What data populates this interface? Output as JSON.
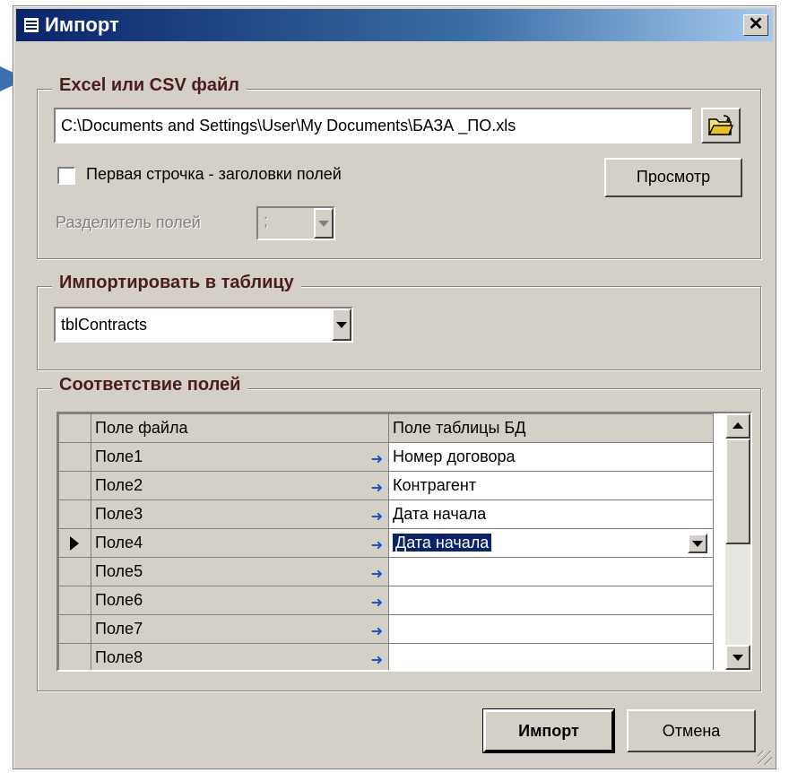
{
  "window": {
    "title": "Импорт",
    "close_symbol": "✕"
  },
  "source_group": {
    "legend": "Excel или CSV файл",
    "file_path": "C:\\Documents and Settings\\User\\My Documents\\БАЗА _ПО.xls",
    "first_row_headers_label": "Первая строчка - заголовки полей",
    "first_row_headers_checked": false,
    "preview_button": "Просмотр",
    "separator_label": "Разделитель полей",
    "separator_value": ";"
  },
  "target_group": {
    "legend": "Импортировать в таблицу",
    "table_value": "tblContracts"
  },
  "mapping_group": {
    "legend": "Соответствие полей",
    "columns": [
      "Поле файла",
      "Поле таблицы БД"
    ],
    "arrow_symbol": "➜",
    "rows": [
      {
        "file": "Поле1",
        "db": "Номер договора"
      },
      {
        "file": "Поле2",
        "db": "Контрагент"
      },
      {
        "file": "Поле3",
        "db": "Дата начала"
      },
      {
        "file": "Поле4",
        "db": "Дата начала"
      },
      {
        "file": "Поле5",
        "db": ""
      },
      {
        "file": "Поле6",
        "db": ""
      },
      {
        "file": "Поле7",
        "db": ""
      },
      {
        "file": "Поле8",
        "db": ""
      }
    ],
    "current_row": 4
  },
  "buttons": {
    "import": "Импорт",
    "cancel": "Отмена"
  },
  "colors": {
    "dialog_bg": "#d4d0c8",
    "title_start": "#0a246a",
    "title_end": "#a6caf0",
    "legend_text": "#4b1c1c",
    "mapping_arrow": "#1a4fd6",
    "selection": "#0a246a"
  }
}
